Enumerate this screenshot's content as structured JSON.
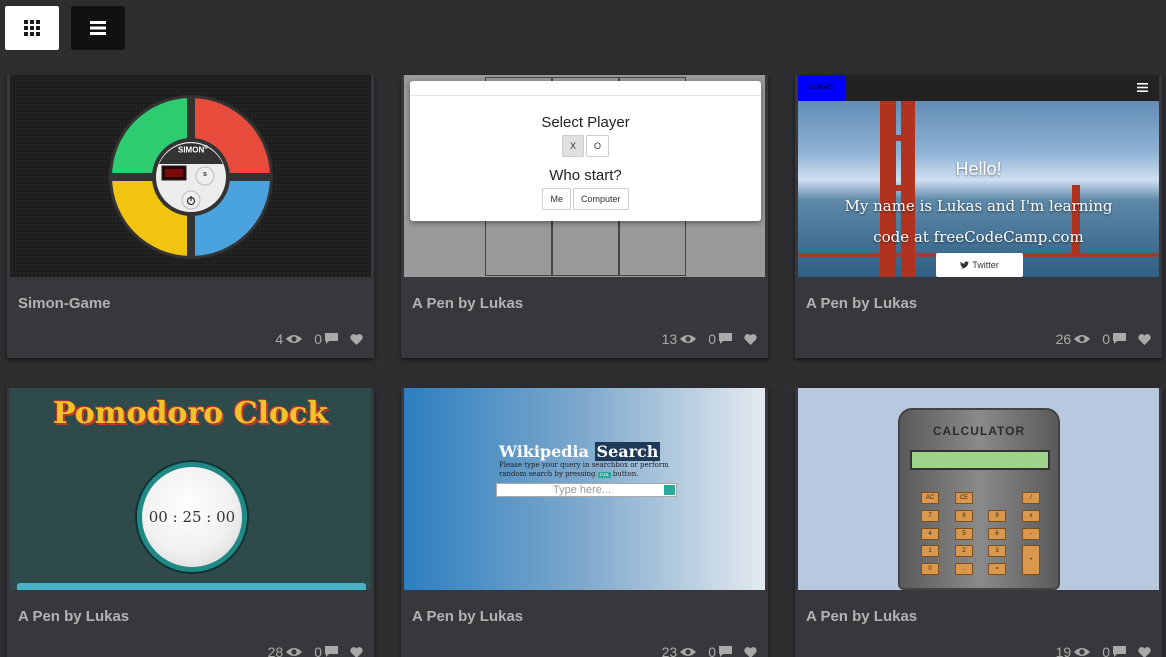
{
  "toolbar": {
    "grid_view_icon": "grid-icon",
    "list_view_icon": "list-icon"
  },
  "cards": [
    {
      "title": "Simon-Game",
      "views": "4",
      "comments": "0",
      "preview": {
        "logo": "SIMON",
        "logo_sup": "®",
        "strict_label": "s"
      }
    },
    {
      "title": "A Pen by Lukas",
      "views": "13",
      "comments": "0",
      "preview": {
        "heading1": "Select Player",
        "opt_x": "X",
        "opt_o": "O",
        "heading2": "Who start?",
        "opt_me": "Me",
        "opt_computer": "Computer"
      }
    },
    {
      "title": "A Pen by Lukas",
      "views": "26",
      "comments": "0",
      "preview": {
        "brand": "LUKAS",
        "hello": "Hello!",
        "subtitle": "My name is Lukas and I'm learning code at freeCodeCamp.com",
        "twitter": "Twitter"
      }
    },
    {
      "title": "A Pen by Lukas",
      "views": "28",
      "comments": "0",
      "preview": {
        "heading": "Pomodoro Clock",
        "time": "00 : 25 : 00"
      }
    },
    {
      "title": "A Pen by Lukas",
      "views": "23",
      "comments": "0",
      "preview": {
        "title_a": "Wikipedia",
        "title_b": "Search",
        "desc_a": "Please type your query in searchbox or perform random search by pressing",
        "desc_btn": "run",
        "desc_b": "button.",
        "placeholder": "Type here..."
      }
    },
    {
      "title": "A Pen by Lukas",
      "views": "19",
      "comments": "0",
      "preview": {
        "heading": "CALCULATOR",
        "keys": [
          "AC",
          "CE",
          "/",
          "7",
          "8",
          "9",
          "x",
          "4",
          "5",
          "6",
          "-",
          "1",
          "2",
          "3",
          "+",
          "0",
          ".",
          "="
        ]
      }
    }
  ],
  "colors": {
    "background": "#2e2e31",
    "card": "#38383c",
    "text_muted": "#b2b2b2",
    "simon_green": "#2ecc71",
    "simon_red": "#e74c3c",
    "simon_yellow": "#f1c40f",
    "simon_blue": "#4aa3df"
  }
}
